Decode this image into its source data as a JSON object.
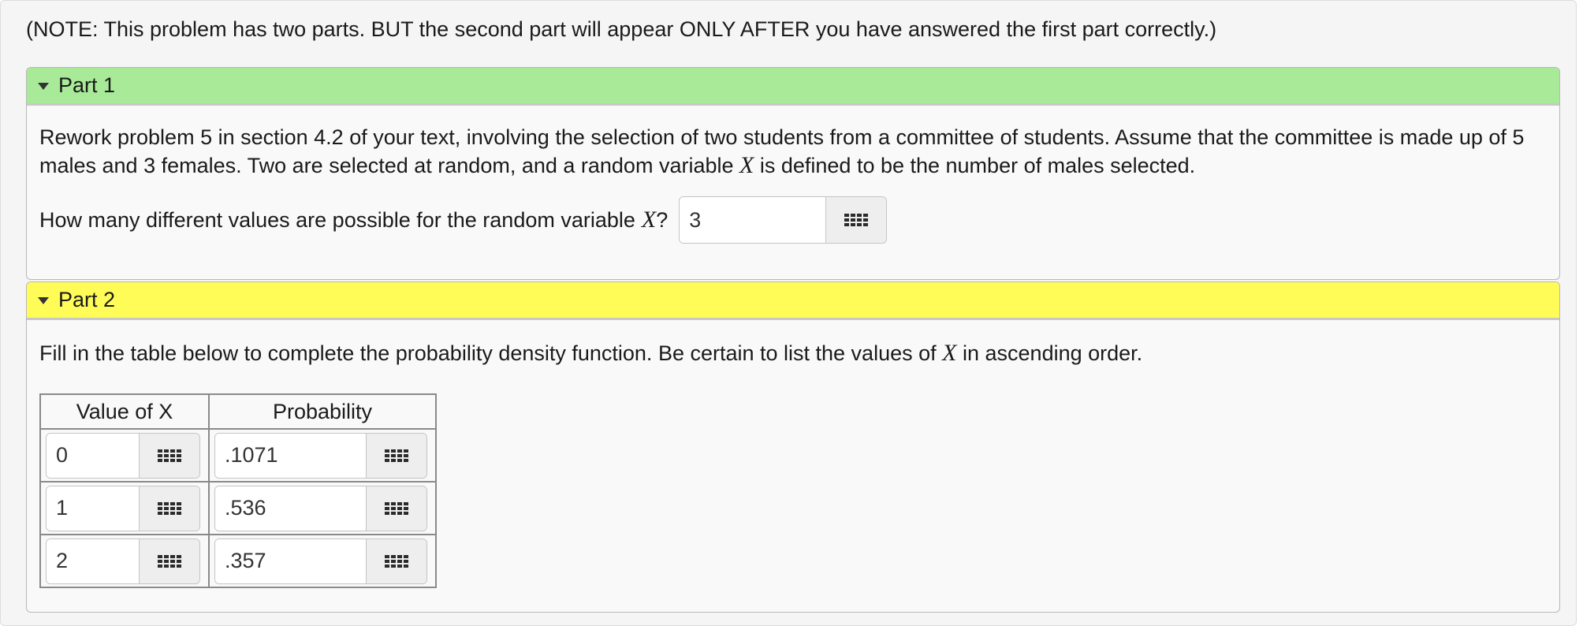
{
  "note": "(NOTE: This problem has two parts. BUT the second part will appear ONLY AFTER you have answered the first part correctly.)",
  "part1": {
    "title": "Part 1",
    "paragraph_before": "Rework problem 5 in section 4.2 of your text, involving the selection of two students from a committee of students. Assume that the committee is made up of 5 males and 3 females. Two are selected at random, and a random variable",
    "variable": "X",
    "paragraph_after": "is defined to be the number of males selected.",
    "question_before": "How many different values are possible for the random variable",
    "question_after": "?",
    "answer": "3"
  },
  "part2": {
    "title": "Part 2",
    "instruction_before": "Fill in the table below to complete the probability density function. Be certain to list the values of",
    "instruction_after": "in ascending order.",
    "table": {
      "headers": [
        "Value of X",
        "Probability"
      ],
      "rows": [
        {
          "value": "0",
          "probability": ".1071"
        },
        {
          "value": "1",
          "probability": ".536"
        },
        {
          "value": "2",
          "probability": ".357"
        }
      ]
    }
  },
  "icons": {
    "header_toggle": "caret-down-icon",
    "equation_editor": "grid-keypad-icon"
  },
  "colors": {
    "part1_header": "#a8ea98",
    "part2_header": "#fffc58"
  }
}
